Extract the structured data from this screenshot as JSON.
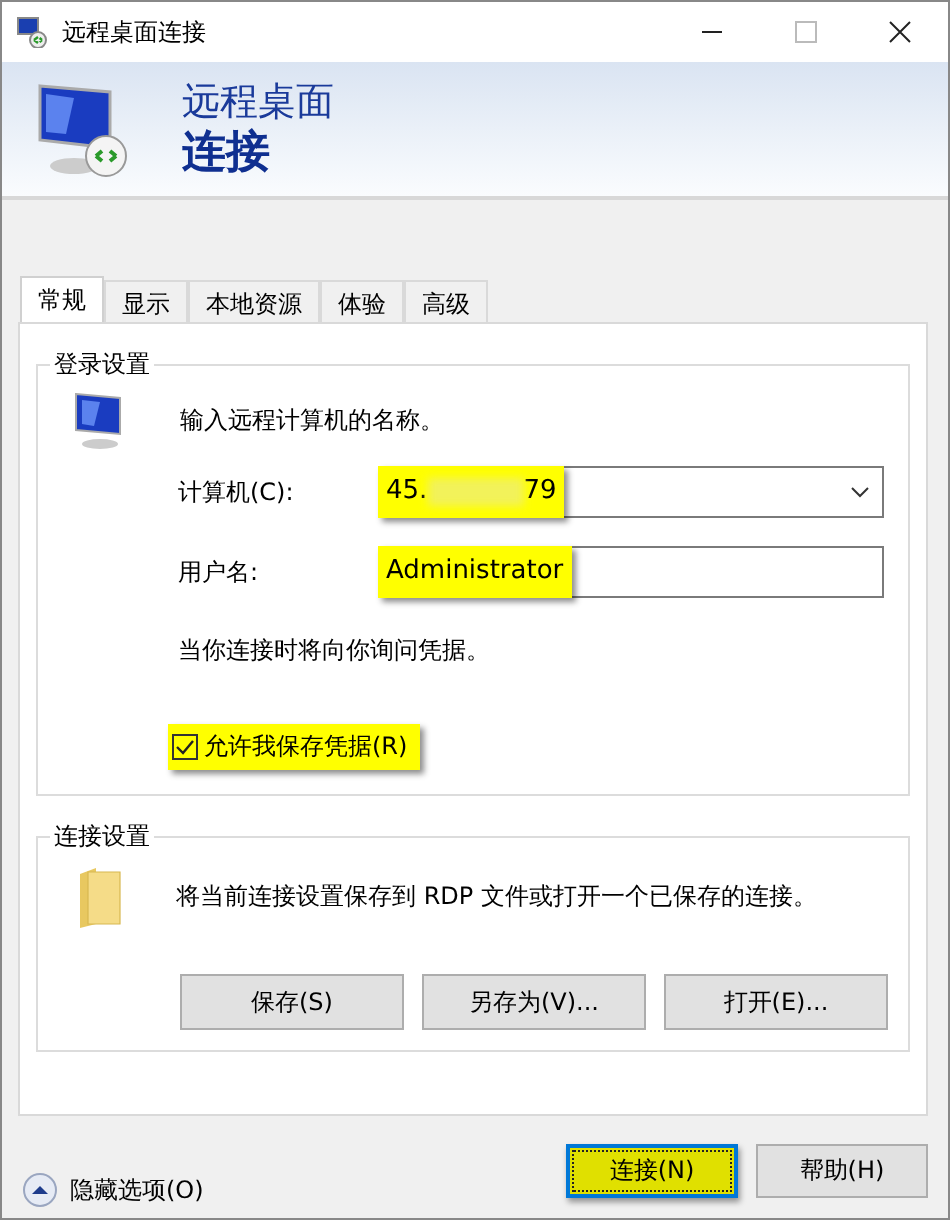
{
  "window": {
    "title": "远程桌面连接"
  },
  "header": {
    "line1": "远程桌面",
    "line2": "连接"
  },
  "tabs": [
    {
      "label": "常规",
      "selected": true
    },
    {
      "label": "显示",
      "selected": false
    },
    {
      "label": "本地资源",
      "selected": false
    },
    {
      "label": "体验",
      "selected": false
    },
    {
      "label": "高级",
      "selected": false
    }
  ],
  "login_group": {
    "title": "登录设置",
    "prompt": "输入远程计算机的名称。",
    "computer": {
      "label": "计算机(C):",
      "value_start": "45.",
      "value_end": "79",
      "highlighted": true
    },
    "username": {
      "label": "用户名:",
      "value": "Administrator",
      "highlighted": true
    },
    "note": "当你连接时将向你询问凭据。",
    "save_credentials": {
      "label": "允许我保存凭据(R)",
      "checked": true,
      "highlighted": true
    }
  },
  "connection_group": {
    "title": "连接设置",
    "description": "将当前连接设置保存到 RDP 文件或打开一个已保存的连接。",
    "buttons": [
      "保存(S)",
      "另存为(V)...",
      "打开(E)..."
    ]
  },
  "options_toggle": {
    "label": "隐藏选项(O)",
    "expanded": true
  },
  "buttons": [
    {
      "label": "连接(N)",
      "default": true,
      "highlighted": true
    },
    {
      "label": "帮助(H)",
      "default": false,
      "highlighted": false
    }
  ]
}
